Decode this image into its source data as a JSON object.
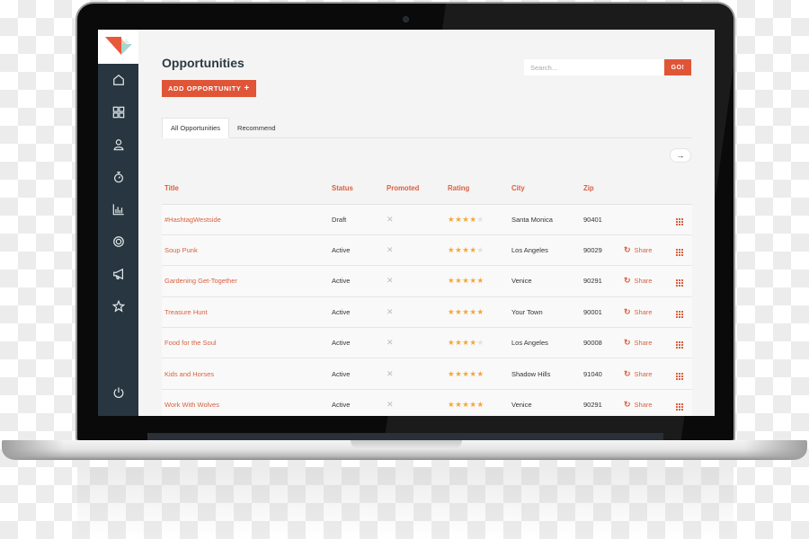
{
  "app": {
    "page_title": "Opportunities",
    "add_button_label": "ADD OPPORTUNITY",
    "add_button_icon": "plus-icon"
  },
  "sidebar": {
    "logo": "brand-logo",
    "items": [
      {
        "name": "home",
        "icon": "home-icon"
      },
      {
        "name": "dashboard",
        "icon": "grid-icon"
      },
      {
        "name": "profile",
        "icon": "user-icon"
      },
      {
        "name": "timer",
        "icon": "stopwatch-icon"
      },
      {
        "name": "analytics",
        "icon": "bar-chart-icon"
      },
      {
        "name": "settings",
        "icon": "gear-icon"
      },
      {
        "name": "campaigns",
        "icon": "megaphone-icon"
      },
      {
        "name": "favorites",
        "icon": "star-icon"
      }
    ],
    "footer_item": {
      "name": "logout",
      "icon": "power-icon"
    }
  },
  "search": {
    "placeholder": "Search...",
    "value": "",
    "button_label": "GO!"
  },
  "tabs": [
    {
      "label": "All Opportunities",
      "active": true
    },
    {
      "label": "Recommend",
      "active": false
    }
  ],
  "pager": {
    "next_icon": "arrow-right-icon",
    "label": "→"
  },
  "table": {
    "columns": [
      "Title",
      "Status",
      "Promoted",
      "Rating",
      "City",
      "Zip",
      "",
      ""
    ],
    "rows": [
      {
        "title": "#HashtagWestside",
        "status": "Draft",
        "promoted": "✕",
        "rating": 4,
        "city": "Santa Monica",
        "zip": "90401",
        "share": ""
      },
      {
        "title": "Soup Punk",
        "status": "Active",
        "promoted": "✕",
        "rating": 4,
        "city": "Los Angeles",
        "zip": "90029",
        "share": "Share"
      },
      {
        "title": "Gardening Get-Together",
        "status": "Active",
        "promoted": "✕",
        "rating": 5,
        "city": "Venice",
        "zip": "90291",
        "share": "Share"
      },
      {
        "title": "Treasure Hunt",
        "status": "Active",
        "promoted": "✕",
        "rating": 5,
        "city": "Your Town",
        "zip": "90001",
        "share": "Share"
      },
      {
        "title": "Food for the Soul",
        "status": "Active",
        "promoted": "✕",
        "rating": 4,
        "city": "Los Angeles",
        "zip": "90008",
        "share": "Share"
      },
      {
        "title": "Kids and Horses",
        "status": "Active",
        "promoted": "✕",
        "rating": 5,
        "city": "Shadow Hills",
        "zip": "91040",
        "share": "Share"
      },
      {
        "title": "Work With Wolves",
        "status": "Active",
        "promoted": "✕",
        "rating": 5,
        "city": "Venice",
        "zip": "90291",
        "share": "Share"
      }
    ],
    "rating_max": 5
  },
  "colors": {
    "accent": "#e05537",
    "link": "#d9603f",
    "star": "#f4a636",
    "sidebar": "#273640"
  }
}
